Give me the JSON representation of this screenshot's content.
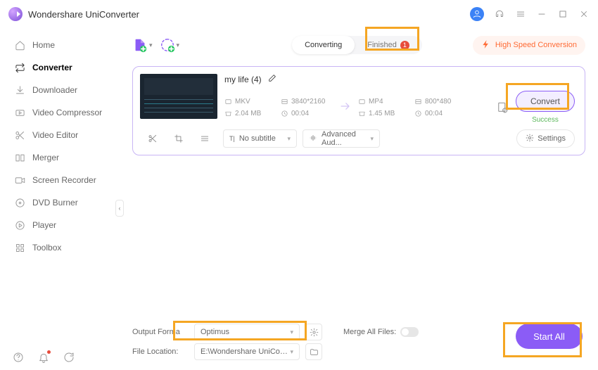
{
  "app": {
    "title": "Wondershare UniConverter"
  },
  "sidebar": {
    "items": [
      {
        "label": "Home"
      },
      {
        "label": "Converter"
      },
      {
        "label": "Downloader"
      },
      {
        "label": "Video Compressor"
      },
      {
        "label": "Video Editor"
      },
      {
        "label": "Merger"
      },
      {
        "label": "Screen Recorder"
      },
      {
        "label": "DVD Burner"
      },
      {
        "label": "Player"
      },
      {
        "label": "Toolbox"
      }
    ]
  },
  "toolbar": {
    "tabs": {
      "converting": "Converting",
      "finished": "Finished",
      "finished_count": "1"
    },
    "high_speed": "High Speed Conversion"
  },
  "file": {
    "title": "my life (4)",
    "src": {
      "format": "MKV",
      "resolution": "3840*2160",
      "size": "2.04 MB",
      "duration": "00:04"
    },
    "dst": {
      "format": "MP4",
      "resolution": "800*480",
      "size": "1.45 MB",
      "duration": "00:04"
    },
    "convert_label": "Convert",
    "status": "Success",
    "subtitle": {
      "value": "No subtitle"
    },
    "audio": {
      "value": "Advanced Aud..."
    },
    "settings_label": "Settings"
  },
  "bottom": {
    "output_format_label": "Output Forma",
    "output_format_value": "Optimus",
    "file_location_label": "File Location:",
    "file_location_value": "E:\\Wondershare UniConverter",
    "merge_label": "Merge All Files:",
    "start_all": "Start All"
  }
}
